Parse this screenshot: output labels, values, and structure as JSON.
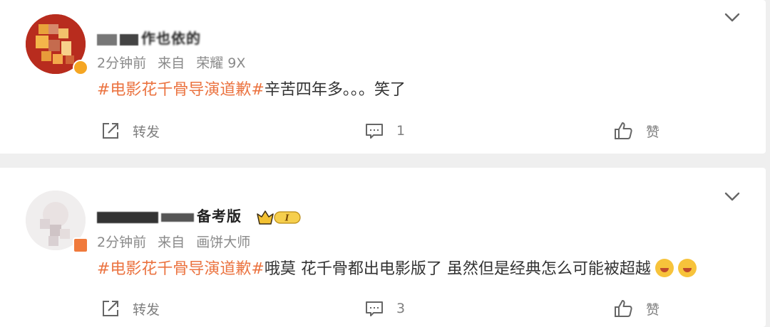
{
  "posts": [
    {
      "username_visible": "作也依的",
      "time": "2分钟前",
      "source_prefix": "来自",
      "device": "荣耀 9X",
      "hashtag": "#电影花千骨导演道歉#",
      "text": "辛苦四年多。。。笑了",
      "repost_label": "转发",
      "comment_count": "1",
      "like_label": "赞"
    },
    {
      "username_visible": "备考版",
      "time": "2分钟前",
      "source_prefix": "来自",
      "device": "画饼大师",
      "hashtag": "#电影花千骨导演道歉#",
      "text": "哦莫 花千骨都出电影版了 虽然但是经典怎么可能被超越",
      "level_badge": "I",
      "repost_label": "转发",
      "comment_count": "3",
      "like_label": "赞"
    }
  ],
  "colors": {
    "hashtag": "#eb7340",
    "meta": "#8a8a8a",
    "background": "#efefef"
  },
  "icons": [
    "chevron-down-icon",
    "repost-icon",
    "comment-icon",
    "like-icon",
    "crown-vip-badge-icon",
    "smiley-emoji-icon"
  ]
}
